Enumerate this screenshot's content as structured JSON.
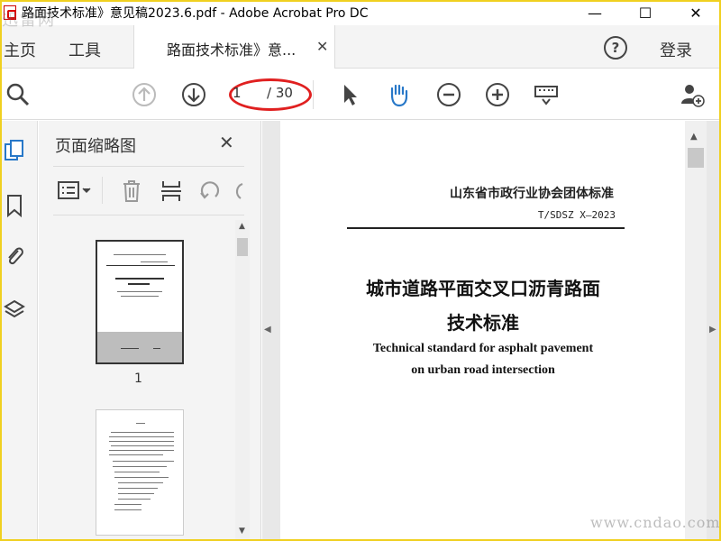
{
  "window": {
    "title": "路面技术标准》意见稿2023.6.pdf - Adobe Acrobat Pro DC",
    "controls": [
      "—",
      "☐",
      "✕"
    ]
  },
  "watermarks": {
    "top": "迅雷网",
    "bottom": "www.cndao.com"
  },
  "tabs": {
    "home": "主页",
    "tools": "工具",
    "document": "路面技术标准》意...",
    "close": "✕",
    "help": "?",
    "sign_in": "登录"
  },
  "toolbar": {
    "icons": [
      "search-icon",
      "page-up-icon",
      "page-down-icon",
      "select-arrow-icon",
      "hand-icon",
      "zoom-out-icon",
      "zoom-in-icon",
      "keyboard-icon",
      "add-user-icon"
    ],
    "current_page": "1",
    "total_pages": "/ 30",
    "accent": "#2878c8"
  },
  "sidebar": {
    "title": "页面缩略图",
    "close": "✕",
    "thumbnails": [
      {
        "label": "1"
      }
    ]
  },
  "document": {
    "organization": "山东省市政行业协会团体标准",
    "standard_no": "T/SDSZ X—2023",
    "title_cn_line1": "城市道路平面交叉口沥青路面",
    "title_cn_line2": "技术标准",
    "title_en_line1": "Technical standard for asphalt pavement",
    "title_en_line2": "on urban road intersection"
  },
  "colors": {
    "frame": "#f0d020",
    "highlight": "#e02020"
  }
}
